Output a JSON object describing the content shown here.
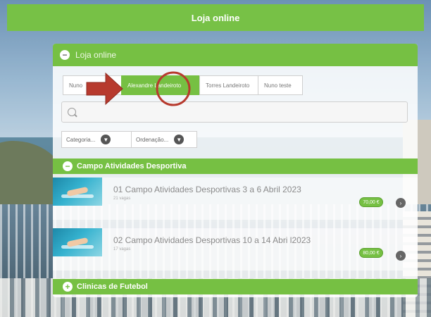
{
  "header": {
    "title": "Loja online"
  },
  "panel": {
    "title": "Loja online"
  },
  "tabs": [
    {
      "label": "Nuno"
    },
    {
      "label": "Alexandre Landeiroto"
    },
    {
      "label": "Torres Landeiroto"
    },
    {
      "label": "Nuno teste"
    }
  ],
  "active_tab": "Alexandre Landeiroto",
  "search": {
    "placeholder": "",
    "value": ""
  },
  "filters": {
    "category_label": "Categoria...",
    "sort_label": "Ordenação..."
  },
  "categories": [
    {
      "label": "Campo Atividades Desportiva",
      "expanded": true
    },
    {
      "label": "Clinicas de Futebol",
      "expanded": false
    }
  ],
  "products": [
    {
      "title": "01 Campo Atividades Desportivas 3 a 6 Abril 2023",
      "subtitle": "21 vagas",
      "price": "70,00 €"
    },
    {
      "title": "02 Campo Atividades Desportivas 10 a 14 Abri l2023",
      "subtitle": "17 vagas",
      "price": "80,00 €"
    }
  ],
  "icons": {
    "panel_toggle": "minus-circle-icon",
    "category_collapse": "minus-circle-icon",
    "category_expand": "plus-circle-icon",
    "dropdown": "chevron-down-circle-icon",
    "product_action": "arrow-circle-icon"
  },
  "colors": {
    "accent_green": "#76c043",
    "annotation_red": "#c0392b"
  }
}
